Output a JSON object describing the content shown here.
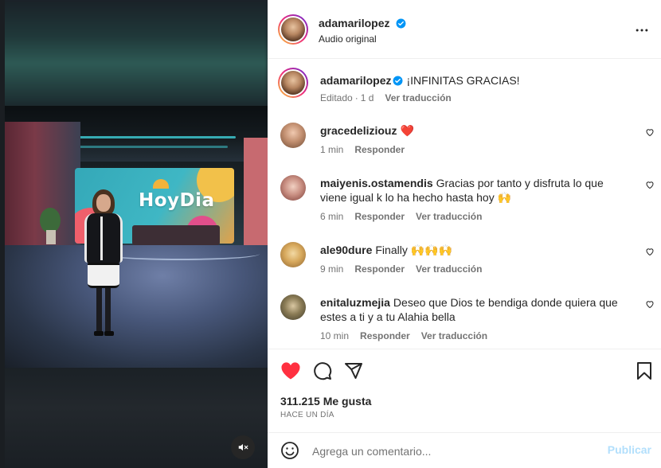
{
  "colors": {
    "accent": "#0095f6",
    "like_red": "#ff3040",
    "muted_text": "#737373",
    "publish_disabled": "#b2dffc"
  },
  "media": {
    "show_logo": "HoyDia",
    "mute_icon": "speaker-muted-icon"
  },
  "header": {
    "username": "adamarilopez",
    "verified": true,
    "audio": "Audio original",
    "more_icon": "more-horizontal-icon"
  },
  "caption": {
    "username": "adamarilopez",
    "text": "¡INFINITAS GRACIAS!",
    "edited": "Editado",
    "dot": "·",
    "age": "1 d",
    "translate": "Ver traducción"
  },
  "comments": [
    {
      "username": "gracedeliziouz",
      "text": "❤️",
      "time": "1 min",
      "reply": "Responder",
      "translate": ""
    },
    {
      "username": "maiyenis.ostamendis",
      "text": "Gracias por tanto y disfruta lo que viene igual k lo ha hecho hasta hoy 🙌",
      "time": "6 min",
      "reply": "Responder",
      "translate": "Ver traducción"
    },
    {
      "username": "ale90dure",
      "text": "Finally 🙌🙌🙌",
      "time": "9 min",
      "reply": "Responder",
      "translate": "Ver traducción"
    },
    {
      "username": "enitaluzmejia",
      "text": "Deseo que Dios te bendiga donde quiera que estes a ti y a tu Alahia bella",
      "time": "10 min",
      "reply": "Responder",
      "translate": "Ver traducción"
    }
  ],
  "actions": {
    "liked": true,
    "likes": "311.215 Me gusta",
    "date": "HACE UN DÍA"
  },
  "composer": {
    "placeholder": "Agrega un comentario...",
    "publish": "Publicar"
  }
}
